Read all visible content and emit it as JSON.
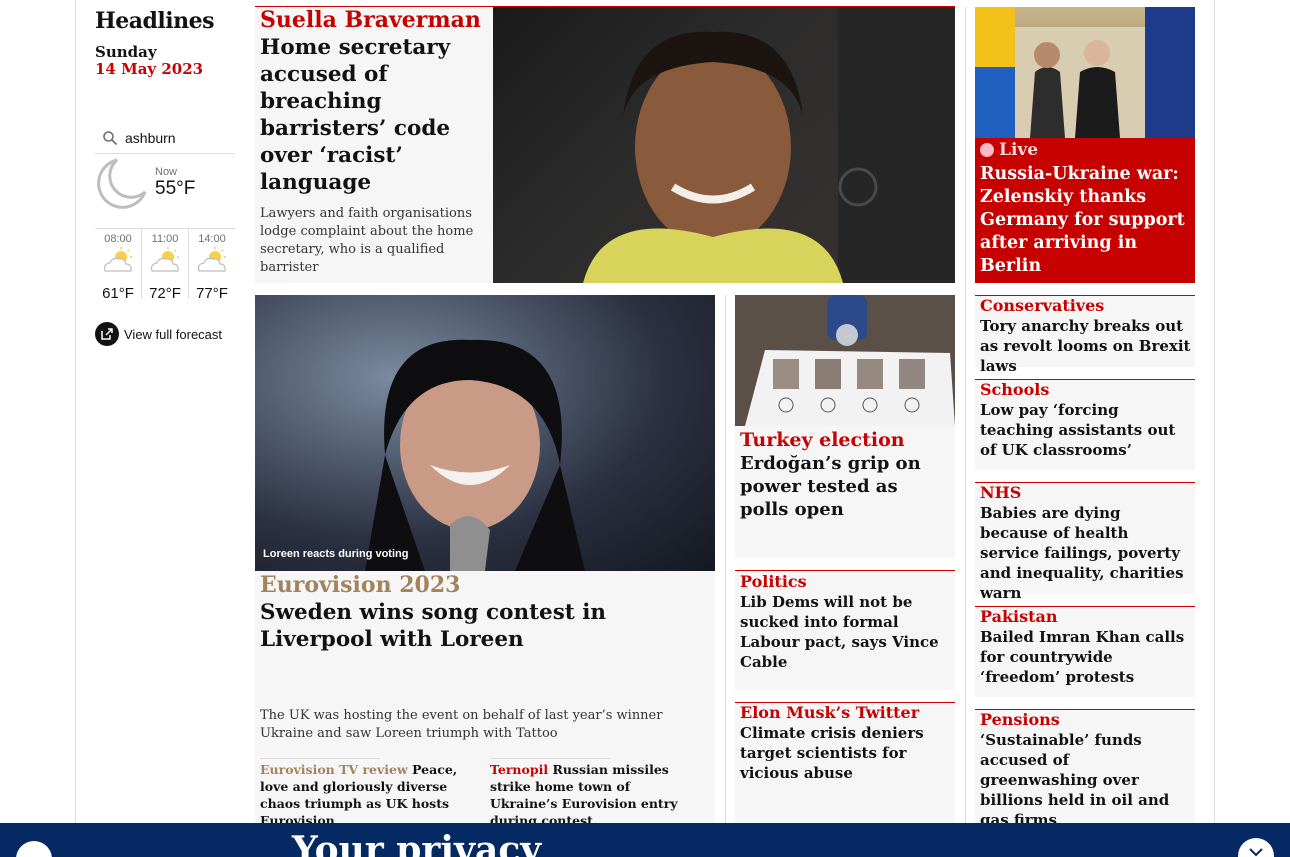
{
  "sidebar": {
    "title": "Headlines",
    "day": "Sunday",
    "date": "14 May 2023",
    "location": "ashburn",
    "now_label": "Now",
    "now_temp": "55°F",
    "forecast": [
      {
        "time": "08:00",
        "temp": "61°F"
      },
      {
        "time": "11:00",
        "temp": "72°F"
      },
      {
        "time": "14:00",
        "temp": "77°F"
      }
    ],
    "full_forecast_label": "View full forecast",
    "icons": {
      "search": "search-icon",
      "moon": "moon-icon",
      "partly_sunny": "partly-sunny-icon",
      "external": "external-link-icon"
    }
  },
  "lead": {
    "kicker": "Suella Braverman",
    "headline": "Home secretary accused of breaching barristers’ code over ‘racist’ language",
    "standfirst": "Lawyers and faith organisations lodge complaint about the home secretary, who is a qualified barrister"
  },
  "live": {
    "badge": "Live",
    "headline": "Russia-Ukraine war: Zelenskiy thanks Germany for support after arriving in Berlin"
  },
  "euro": {
    "caption": "Loreen reacts during voting",
    "kicker": "Eurovision 2023",
    "headline": "Sweden wins song contest in Liverpool with Loreen",
    "standfirst": "The UK was hosting the event on behalf of last year’s winner Ukraine and saw Loreen triumph with Tattoo",
    "sublinks": [
      {
        "kicker": "Eurovision TV review",
        "text": "Peace, love and gloriously diverse chaos triumph as UK hosts Eurovision"
      },
      {
        "kicker": "Ternopil",
        "text": "Russian missiles strike home town of Ukraine’s Eurovision entry during contest"
      }
    ]
  },
  "middle": [
    {
      "kicker": "Turkey election",
      "headline": "Erdoğan’s grip on power tested as polls open"
    },
    {
      "kicker": "Politics",
      "headline": "Lib Dems will not be sucked into formal Labour pact, says Vince Cable"
    },
    {
      "kicker": "Elon Musk’s Twitter",
      "headline": "Climate crisis deniers target scientists for vicious abuse"
    }
  ],
  "right": [
    {
      "kicker": "Conservatives",
      "headline": "Tory anarchy breaks out as revolt looms on Brexit laws"
    },
    {
      "kicker": "Schools",
      "headline": "Low pay ‘forcing teaching assistants out of UK classrooms’"
    },
    {
      "kicker": "NHS",
      "headline": "Babies are dying because of health service failings, poverty and inequality, charities warn"
    },
    {
      "kicker": "Pakistan",
      "headline": "Bailed Imran Khan calls for countrywide ‘freedom’ protests"
    },
    {
      "kicker": "Pensions",
      "headline": "‘Sustainable’ funds accused of greenwashing over billions held in oil and gas firms"
    }
  ],
  "privacy": {
    "title": "Your privacy"
  },
  "colors": {
    "news_red": "#c70000",
    "culture_gold": "#a1845c",
    "brand_blue": "#052962",
    "card_bg": "#f6f6f6"
  }
}
